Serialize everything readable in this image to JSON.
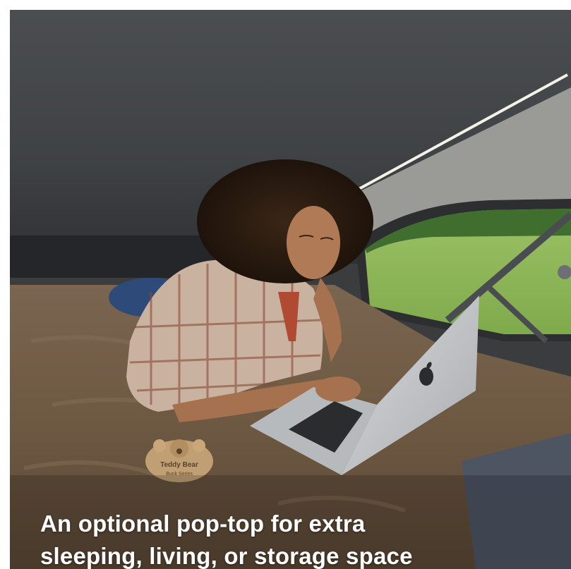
{
  "caption": {
    "line1": "An optional pop-top for extra",
    "line2": "sleeping, living, or storage space"
  },
  "bear_logo": {
    "text": "Teddy Bear",
    "subtext": "Bunk Series"
  },
  "colors": {
    "ceiling": "#46494b",
    "mattress": "#6e5a44",
    "grass": "#8fb85a",
    "trees": "#3f6e2e",
    "laptop": "#c9cbcd",
    "caption_text": "#ffffff"
  }
}
